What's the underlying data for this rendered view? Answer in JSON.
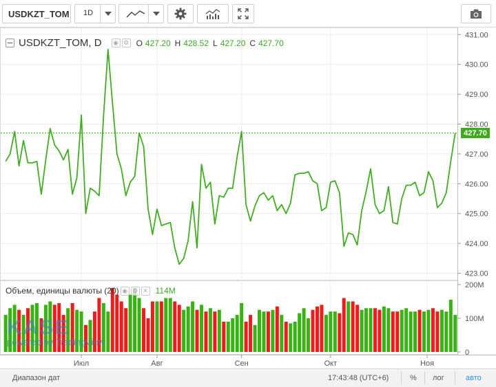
{
  "toolbar": {
    "symbol": "USDKZT_TOM",
    "interval": "1D",
    "icons": [
      "line-chart-icon",
      "gear-icon",
      "indicators-icon",
      "fullscreen-icon",
      "camera-icon"
    ]
  },
  "legend": {
    "symbol": "USDKZT_TOM, D",
    "o_label": "O",
    "o_value": "427.20",
    "h_label": "H",
    "h_value": "428.52",
    "l_label": "L",
    "l_value": "427.20",
    "c_label": "C",
    "c_value": "427.70"
  },
  "volume_legend": {
    "label": "Объем, единицы валюты (20)",
    "value": "114M"
  },
  "last_price_label": "427.70",
  "logo": {
    "text": "KASE",
    "powered": "powered by TradingView"
  },
  "statusbar": {
    "range": "Диапазон дат",
    "time": "17:43:48 (UTC+6)",
    "percent": "%",
    "log": "лог",
    "auto": "авто"
  },
  "colors": {
    "line": "#3fad1f",
    "up": "#38b313",
    "down": "#ee1c1c",
    "grid": "#ececec",
    "last": "#3faa1e",
    "auto": "#2a8fd6"
  },
  "chart_data": {
    "type": "line",
    "price_axis": {
      "min": 423.0,
      "max": 431.0,
      "ticks": [
        "431.00",
        "430.00",
        "429.00",
        "428.00",
        "427.00",
        "426.00",
        "425.00",
        "424.00",
        "423.00"
      ]
    },
    "volume_axis": {
      "max": 200,
      "unit": "M",
      "ticks": [
        "200M",
        "100M",
        "0"
      ]
    },
    "x_ticks": [
      "Июл",
      "Авг",
      "Сен",
      "Окт",
      "Ноя"
    ],
    "last": 427.7,
    "series": [
      {
        "values": [
          426.75,
          427.0,
          427.75,
          426.6,
          427.45,
          426.7,
          426.7,
          426.75,
          425.65,
          426.8,
          427.85,
          427.3,
          427.1,
          426.8,
          427.15,
          425.65,
          426.2,
          428.3,
          425.0,
          425.85,
          425.75,
          425.6,
          428.3,
          430.5,
          428.7,
          427.0,
          426.5,
          425.6,
          426.05,
          426.25,
          427.7,
          427.25,
          425.15,
          424.3,
          425.15,
          424.6,
          424.65,
          424.7,
          423.85,
          423.3,
          423.5,
          424.1,
          425.4,
          423.85,
          426.65,
          425.85,
          426.05,
          424.65,
          425.6,
          425.55,
          425.85,
          425.85,
          426.9,
          427.75,
          425.3,
          424.75,
          425.25,
          425.6,
          425.7,
          425.45,
          425.6,
          425.1,
          425.3,
          425.0,
          425.35,
          426.3,
          426.35,
          426.35,
          426.4,
          426.1,
          426.0,
          425.1,
          425.2,
          426.05,
          426.1,
          425.7,
          423.9,
          424.35,
          424.3,
          423.95,
          425.1,
          425.75,
          426.5,
          425.3,
          425.0,
          425.1,
          425.9,
          424.7,
          424.65,
          425.5,
          425.95,
          425.95,
          426.05,
          425.6,
          425.7,
          426.4,
          426.1,
          425.2,
          425.35,
          425.7,
          426.75,
          427.7
        ]
      },
      {
        "values": [
          110,
          130,
          140,
          125,
          110,
          130,
          140,
          145,
          100,
          140,
          150,
          140,
          145,
          110,
          130,
          145,
          125,
          120,
          80,
          95,
          120,
          160,
          145,
          120,
          190,
          170,
          150,
          130,
          170,
          190,
          160,
          130,
          100,
          150,
          150,
          150,
          160,
          160,
          150,
          140,
          125,
          135,
          150,
          125,
          140,
          120,
          130,
          120,
          125,
          90,
          90,
          100,
          110,
          145,
          90,
          110,
          80,
          125,
          120,
          120,
          125,
          135,
          110,
          90,
          85,
          90,
          115,
          130,
          100,
          125,
          135,
          140,
          110,
          120,
          120,
          115,
          160,
          150,
          150,
          140,
          125,
          130,
          130,
          130,
          125,
          135,
          130,
          120,
          120,
          125,
          130,
          120,
          120,
          125,
          120,
          125,
          130,
          120,
          125,
          120,
          155,
          110
        ]
      }
    ]
  }
}
